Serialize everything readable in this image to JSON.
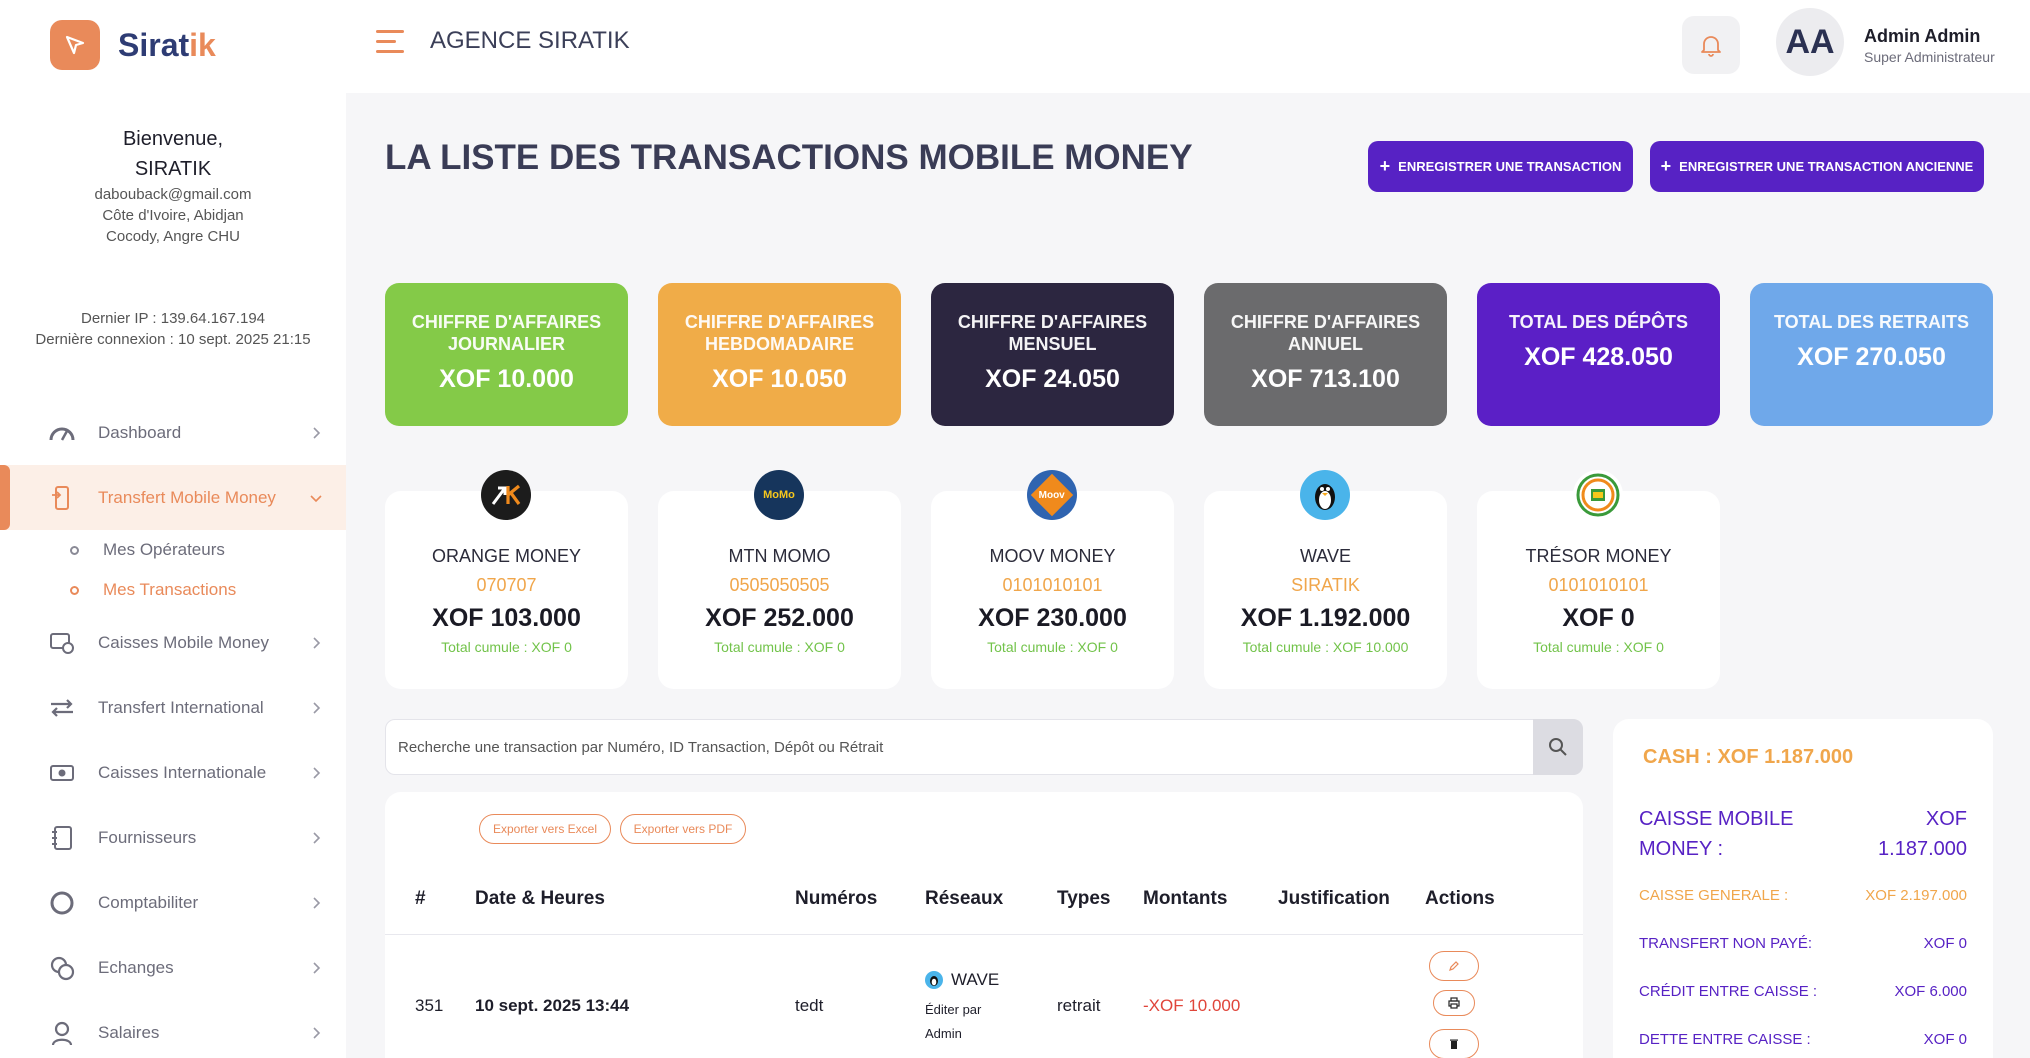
{
  "brand": {
    "name_main": "Sirat",
    "name_accent": "ik"
  },
  "user": {
    "welcome": "Bienvenue,",
    "org": "SIRATIK",
    "email": "dabouback@gmail.com",
    "location": "Côte d'Ivoire, Abidjan",
    "address": "Cocody, Angre CHU",
    "ip": "Dernier IP : 139.64.167.194",
    "last_login": "Dernière connexion : 10 sept. 2025 21:15"
  },
  "sidebar": {
    "items": [
      {
        "label": "Dashboard",
        "icon": "dashboard-icon"
      },
      {
        "label": "Transfert Mobile Money",
        "icon": "phone-transfer-icon"
      },
      {
        "label": "Caisses Mobile Money",
        "icon": "cash-register-icon"
      },
      {
        "label": "Transfert International",
        "icon": "swap-icon"
      },
      {
        "label": "Caisses Internationale",
        "icon": "money-icon"
      },
      {
        "label": "Fournisseurs",
        "icon": "notebook-icon"
      },
      {
        "label": "Comptabiliter",
        "icon": "circle-icon"
      },
      {
        "label": "Echanges",
        "icon": "coins-icon"
      },
      {
        "label": "Salaires",
        "icon": "person-icon"
      }
    ],
    "sub_items": [
      {
        "label": "Mes Opérateurs"
      },
      {
        "label": "Mes Transactions"
      }
    ]
  },
  "header": {
    "agency": "AGENCE SIRATIK",
    "avatar": "AA",
    "user_name": "Admin Admin",
    "user_role": "Super Administrateur"
  },
  "page": {
    "title": "LA LISTE DES TRANSACTIONS MOBILE MONEY",
    "btn_new": "ENREGISTRER UNE TRANSACTION",
    "btn_old": "ENREGISTRER UNE TRANSACTION ANCIENNE"
  },
  "kpis": [
    {
      "l1": "CHIFFRE D'AFFAIRES",
      "l2": "JOURNALIER",
      "value": "XOF 10.000",
      "color": "#84ca48"
    },
    {
      "l1": "CHIFFRE D'AFFAIRES",
      "l2": "HEBDOMADAIRE",
      "value": "XOF 10.050",
      "color": "#f0ac48"
    },
    {
      "l1": "CHIFFRE D'AFFAIRES",
      "l2": "MENSUEL",
      "value": "XOF 24.050",
      "color": "#2c2640"
    },
    {
      "l1": "CHIFFRE D'AFFAIRES",
      "l2": "ANNUEL",
      "value": "XOF 713.100",
      "color": "#6b6b6d"
    },
    {
      "l1": "TOTAL DES DÉPÔTS",
      "l2": "",
      "value": "XOF 428.050",
      "color": "#5b1fc6"
    },
    {
      "l1": "TOTAL DES RETRAITS",
      "l2": "",
      "value": "XOF 270.050",
      "color": "#6fa8ea"
    }
  ],
  "operators": [
    {
      "name": "ORANGE MONEY",
      "number": "070707",
      "amount": "XOF 103.000",
      "total": "Total cumule : XOF 0",
      "logo_text": "OM",
      "logo_color": "#1c1c1c"
    },
    {
      "name": "MTN MOMO",
      "number": "0505050505",
      "amount": "XOF 252.000",
      "total": "Total cumule : XOF 0",
      "logo_text": "MoMo",
      "logo_color": "#16355c"
    },
    {
      "name": "MOOV MONEY",
      "number": "0101010101",
      "amount": "XOF 230.000",
      "total": "Total cumule : XOF 0",
      "logo_text": "Moov",
      "logo_color": "#2f64b0"
    },
    {
      "name": "WAVE",
      "number": "SIRATIK",
      "amount": "XOF 1.192.000",
      "total": "Total cumule : XOF 10.000",
      "logo_text": "",
      "logo_color": "#4ab4ea"
    },
    {
      "name": "TRÉSOR MONEY",
      "number": "0101010101",
      "amount": "XOF 0",
      "total": "Total cumule : XOF 0",
      "logo_text": "",
      "logo_color": "#e7f1e0"
    }
  ],
  "search": {
    "placeholder": "Recherche une transaction par Numéro, ID Transaction, Dépôt ou Rétrait"
  },
  "table": {
    "export_excel": "Exporter vers Excel",
    "export_pdf": "Exporter vers PDF",
    "headers": [
      "#",
      "Date & Heures",
      "Numéros",
      "Réseaux",
      "Types",
      "Montants",
      "Justification",
      "Actions"
    ],
    "rows": [
      {
        "id": "351",
        "date": "10 sept. 2025 13:44",
        "numero": "tedt",
        "reseau": "WAVE",
        "edit_1": "Éditer par",
        "edit_2": "Admin",
        "type": "retrait",
        "montant": "-XOF 10.000",
        "justification": ""
      }
    ]
  },
  "cash": {
    "title": "CASH : XOF 1.187.000",
    "caisse_mm_label": "CAISSE MOBILE MONEY :",
    "caisse_mm_value_1": "XOF",
    "caisse_mm_value_2": "1.187.000",
    "rows": [
      {
        "label": "CAISSE GENERALE :",
        "value": "XOF 2.197.000",
        "color": "#f0a64b"
      },
      {
        "label": "TRANSFERT NON PAYÉ:",
        "value": "XOF 0",
        "color": "#5722c4"
      },
      {
        "label": "CRÉDIT ENTRE CAISSE :",
        "value": "XOF 6.000",
        "color": "#5722c4"
      },
      {
        "label": "DETTE ENTRE CAISSE :",
        "value": "XOF 0",
        "color": "#5722c4"
      }
    ]
  }
}
